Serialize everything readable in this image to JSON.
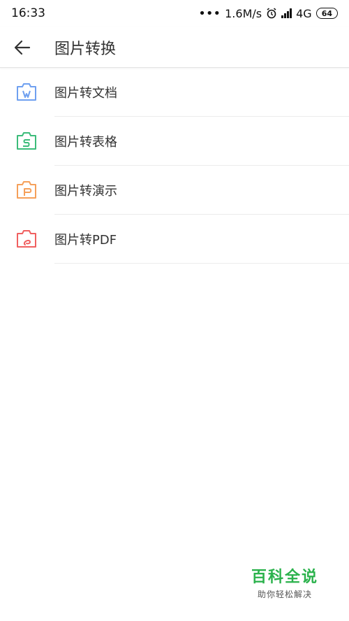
{
  "status_bar": {
    "time": "16:33",
    "dots": "•••",
    "speed": "1.6M/s",
    "network": "4G",
    "battery": "64",
    "icons": [
      "alarm-icon",
      "signal-icon",
      "battery-icon"
    ]
  },
  "app_bar": {
    "back_icon": "arrow-left-icon",
    "title": "图片转换"
  },
  "items": [
    {
      "label": "图片转文档",
      "icon": "image-to-document-icon",
      "color": "#6fa0f0"
    },
    {
      "label": "图片转表格",
      "icon": "image-to-sheet-icon",
      "color": "#3cbc7a"
    },
    {
      "label": "图片转演示",
      "icon": "image-to-presentation-icon",
      "color": "#f5a05a"
    },
    {
      "label": "图片转PDF",
      "icon": "image-to-pdf-icon",
      "color": "#f06060"
    }
  ],
  "watermark": {
    "title": "百科全说",
    "subtitle": "助你轻松解决"
  }
}
